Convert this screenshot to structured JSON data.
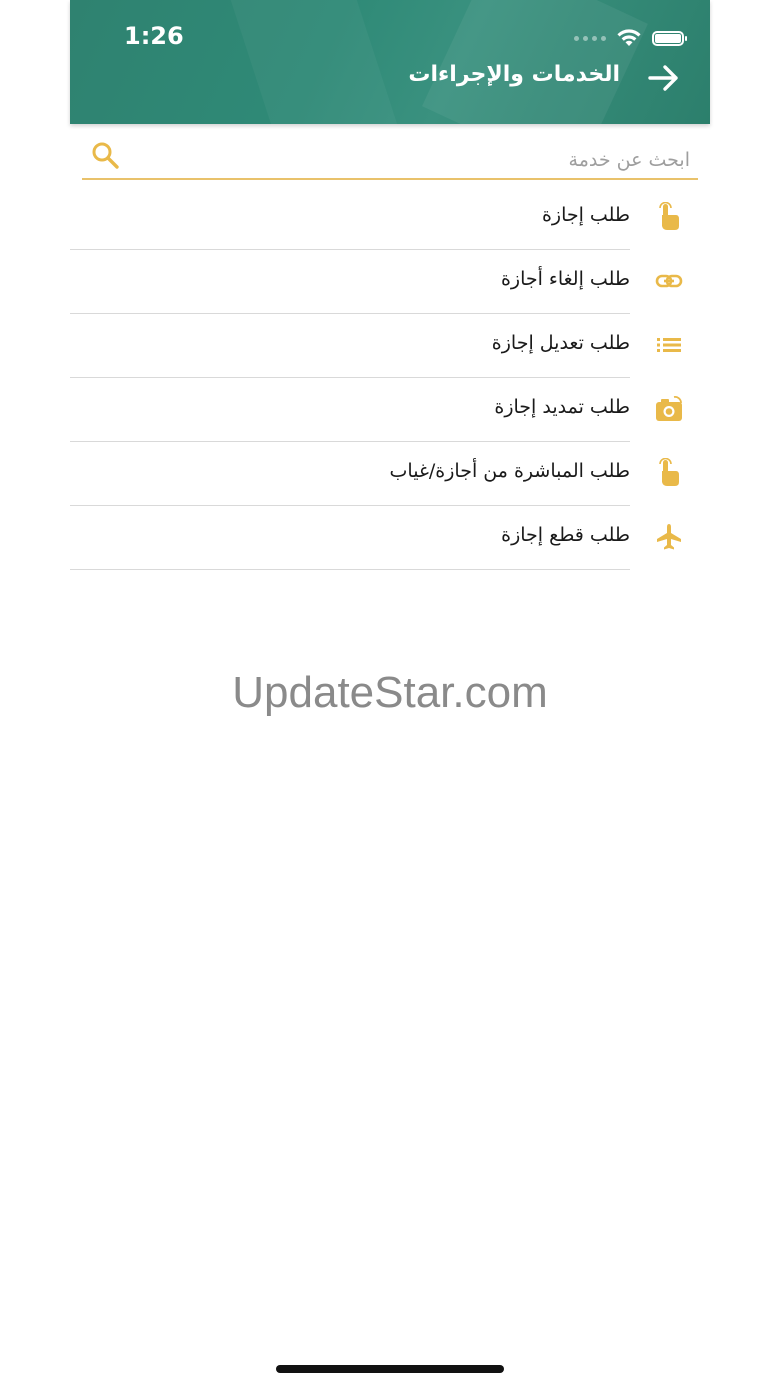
{
  "status_bar": {
    "time": "1:26"
  },
  "header": {
    "title": "الخدمات والإجراءات",
    "back_icon": "arrow-right-icon"
  },
  "search": {
    "placeholder": "ابحث عن خدمة",
    "value": "",
    "icon": "search-icon"
  },
  "colors": {
    "header": "#2f8a77",
    "accent": "#e9b949"
  },
  "items": [
    {
      "label": "طلب إجازة",
      "icon": "touch-hand-icon"
    },
    {
      "label": "طلب إلغاء أجازة",
      "icon": "link-icon"
    },
    {
      "label": "طلب تعديل إجازة",
      "icon": "list-icon"
    },
    {
      "label": "طلب تمديد إجازة",
      "icon": "camera-icon"
    },
    {
      "label": "طلب المباشرة من أجازة/غياب",
      "icon": "touch-hand-icon"
    },
    {
      "label": "طلب قطع إجازة",
      "icon": "airplane-icon"
    }
  ],
  "watermark": "UpdateStar.com"
}
